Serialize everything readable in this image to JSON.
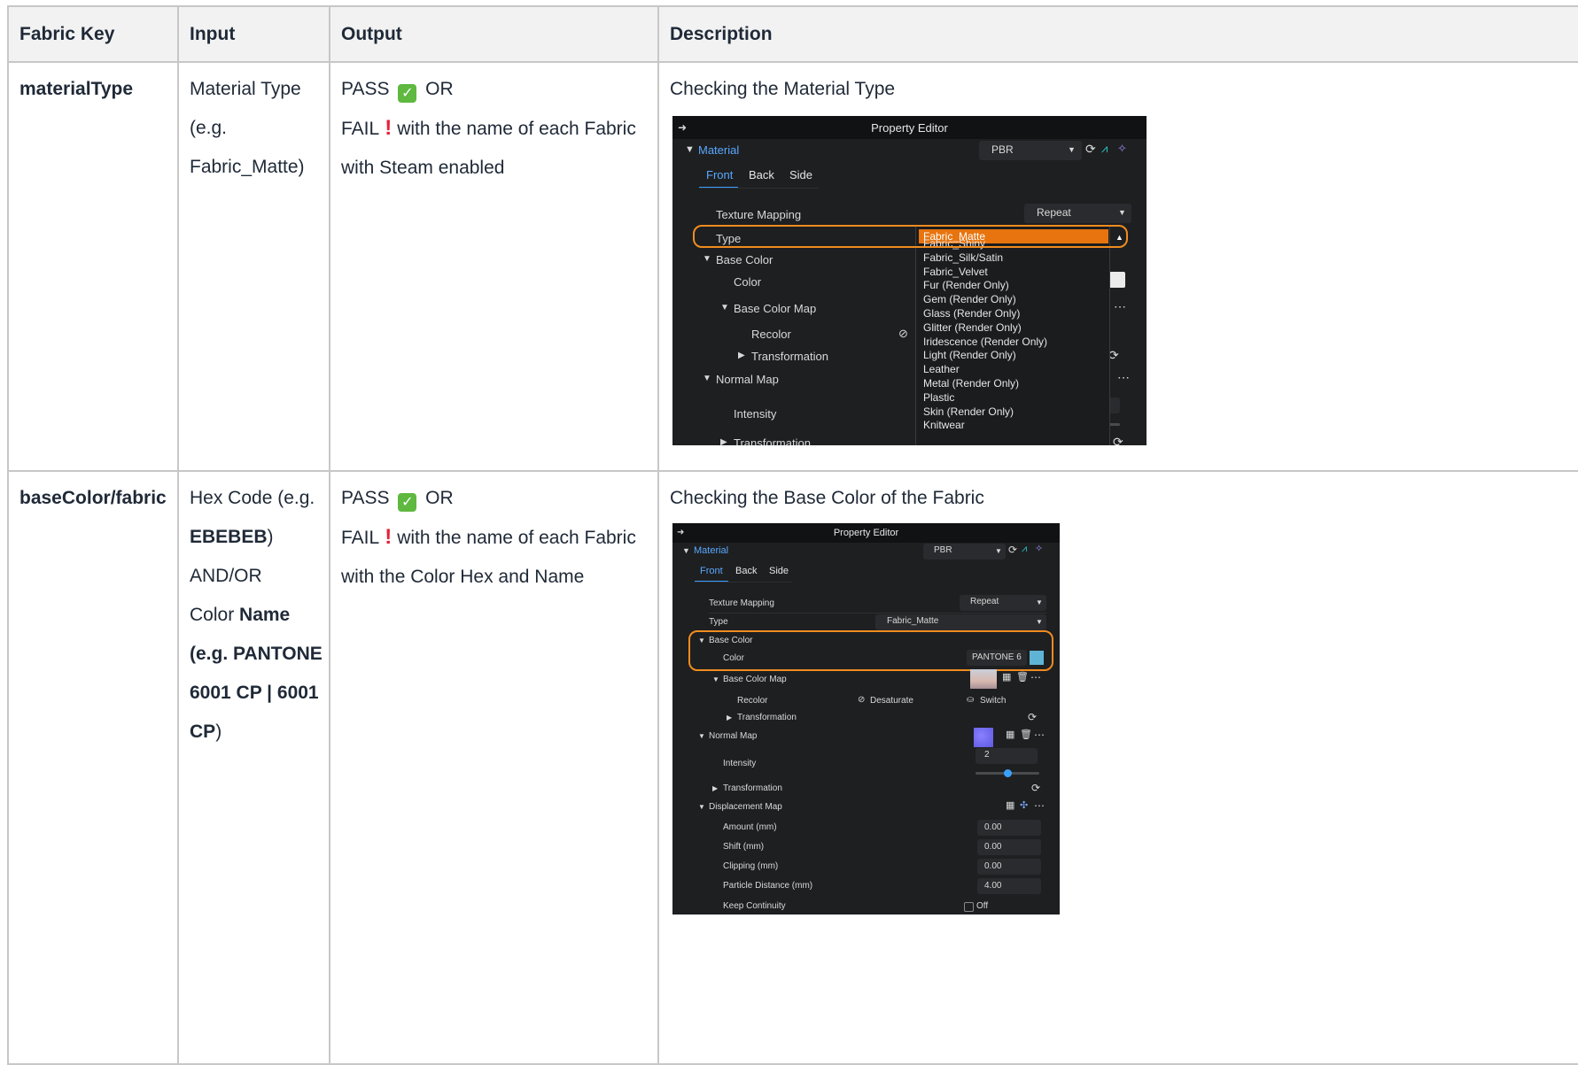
{
  "table": {
    "headers": [
      "Fabric Key",
      "Input",
      "Output",
      "Description"
    ],
    "rows": [
      {
        "key": "materialType",
        "input_lines": [
          "Material Type",
          "(e.g.",
          "Fabric_Matte)"
        ],
        "output_pass": "PASS",
        "output_or": "OR",
        "output_fail": "FAIL",
        "output_fail_rest": "with the name of each Fabric",
        "output_line3": "with Steam enabled",
        "description": "Checking the Material Type"
      },
      {
        "key": "baseColor/fabric",
        "input_hex_prefix": "Hex Code (e.g.",
        "input_hex_value": "EBEBEB",
        "input_hex_suffix": ")",
        "input_andor": "AND/OR",
        "input_color": "Color",
        "input_name_bold": "Name",
        "input_eg_bold": "(e.g. PANTONE",
        "input_code_bold": "6001 CP | 6001",
        "input_cp_bold": "CP",
        "input_close": ")",
        "output_pass": "PASS",
        "output_or": "OR",
        "output_fail": "FAIL",
        "output_fail_rest": "with the name of each Fabric",
        "output_line3": "with the Color Hex and Name",
        "description": "Checking the Base Color of the Fabric"
      }
    ]
  },
  "editor1": {
    "title": "Property Editor",
    "material_label": "Material",
    "material_value": "PBR",
    "tabs": [
      "Front",
      "Back",
      "Side"
    ],
    "texture_mapping_label": "Texture Mapping",
    "texture_mapping_value": "Repeat",
    "type_label": "Type",
    "base_color_label": "Base Color",
    "color_label": "Color",
    "base_color_map_label": "Base Color Map",
    "recolor_label": "Recolor",
    "transformation_label": "Transformation",
    "normal_map_label": "Normal Map",
    "intensity_label": "Intensity",
    "transformation2_label": "Transformation",
    "type_options": [
      "Fabric_Matte",
      "Fabric_Shiny",
      "Fabric_Silk/Satin",
      "Fabric_Velvet",
      "Fur (Render Only)",
      "Gem (Render Only)",
      "Glass (Render Only)",
      "Glitter (Render Only)",
      "Iridescence (Render Only)",
      "Light (Render Only)",
      "Leather",
      "Metal (Render Only)",
      "Plastic",
      "Skin (Render Only)",
      "Knitwear"
    ],
    "selected_option": "Fabric_Matte"
  },
  "editor2": {
    "title": "Property Editor",
    "material_label": "Material",
    "material_value": "PBR",
    "tabs": [
      "Front",
      "Back",
      "Side"
    ],
    "texture_mapping_label": "Texture Mapping",
    "texture_mapping_value": "Repeat",
    "type_label": "Type",
    "type_value": "Fabric_Matte",
    "base_color_label": "Base Color",
    "color_label": "Color",
    "color_value": "PANTONE 6",
    "color_swatch": "#5fb4d6",
    "base_color_map_label": "Base Color Map",
    "recolor_label": "Recolor",
    "desaturate_label": "Desaturate",
    "switch_label": "Switch",
    "transformation_label": "Transformation",
    "normal_map_label": "Normal Map",
    "intensity_label": "Intensity",
    "intensity_value": "2",
    "intensity_level": 0.5,
    "transformation2_label": "Transformation",
    "displacement_label": "Displacement Map",
    "amount_label": "Amount (mm)",
    "amount_value": "0.00",
    "shift_label": "Shift (mm)",
    "shift_value": "0.00",
    "clipping_label": "Clipping (mm)",
    "clipping_value": "0.00",
    "particle_label": "Particle Distance (mm)",
    "particle_value": "4.00",
    "keep_label": "Keep Continuity",
    "keep_value": "Off"
  },
  "colors": {
    "accent_blue": "#3aa0ff",
    "highlight_orange": "#f08c1f",
    "selected_orange": "#e7740f"
  }
}
